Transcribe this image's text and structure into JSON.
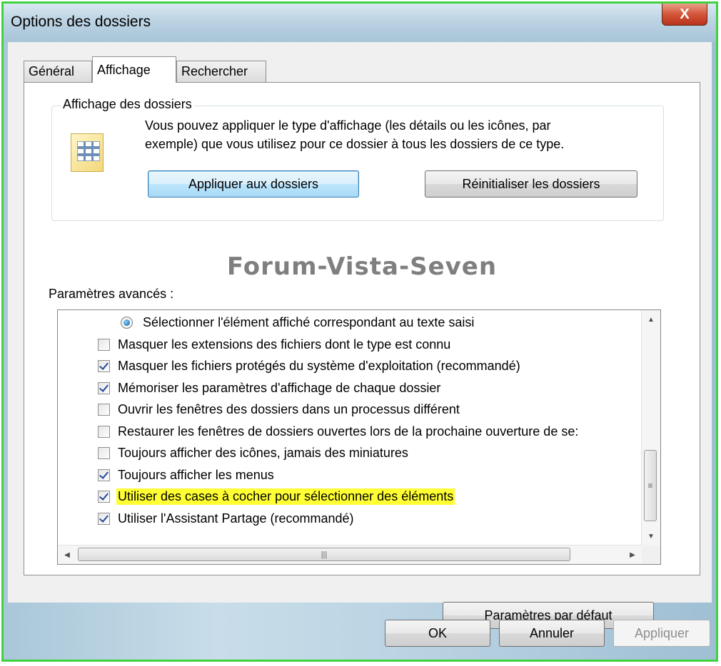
{
  "window": {
    "title": "Options des dossiers",
    "close_glyph": "X"
  },
  "tabs": [
    {
      "label": "Général",
      "active": false
    },
    {
      "label": "Affichage",
      "active": true
    },
    {
      "label": "Rechercher",
      "active": false
    }
  ],
  "folder_view": {
    "group_label": "Affichage des dossiers",
    "icon": "folder-view-icon",
    "description_line1": "Vous pouvez appliquer le type d'affichage (les détails ou les icônes, par",
    "description_line2": "exemple) que vous utilisez pour ce dossier à tous les dossiers de ce type.",
    "apply_button": "Appliquer aux dossiers",
    "reset_button": "Réinitialiser les dossiers"
  },
  "watermark": "Forum-Vista-Seven",
  "advanced": {
    "label": "Paramètres avancés :",
    "items": [
      {
        "type": "radio",
        "checked": true,
        "label": "Sélectionner l'élément affiché correspondant au texte saisi",
        "highlighted": false
      },
      {
        "type": "checkbox",
        "checked": false,
        "label": "Masquer les extensions des fichiers dont le type est connu",
        "highlighted": false
      },
      {
        "type": "checkbox",
        "checked": true,
        "label": "Masquer les fichiers protégés du système d'exploitation (recommandé)",
        "highlighted": false
      },
      {
        "type": "checkbox",
        "checked": true,
        "label": "Mémoriser les paramètres d'affichage de chaque dossier",
        "highlighted": false
      },
      {
        "type": "checkbox",
        "checked": false,
        "label": "Ouvrir les fenêtres des dossiers dans un processus différent",
        "highlighted": false
      },
      {
        "type": "checkbox",
        "checked": false,
        "label": "Restaurer les fenêtres de dossiers ouvertes lors de la prochaine ouverture de se:",
        "highlighted": false
      },
      {
        "type": "checkbox",
        "checked": false,
        "label": "Toujours afficher des icônes, jamais des miniatures",
        "highlighted": false
      },
      {
        "type": "checkbox",
        "checked": true,
        "label": "Toujours afficher les menus",
        "highlighted": false
      },
      {
        "type": "checkbox",
        "checked": true,
        "label": "Utiliser des cases à cocher pour sélectionner des éléments",
        "highlighted": true
      },
      {
        "type": "checkbox",
        "checked": true,
        "label": "Utiliser l'Assistant Partage (recommandé)",
        "highlighted": false
      }
    ],
    "defaults_button": "Paramètres par défaut"
  },
  "footer": {
    "ok": "OK",
    "cancel": "Annuler",
    "apply": "Appliquer"
  },
  "colors": {
    "highlight": "#ffff33",
    "watermark": "#7f7f7f",
    "frame_border": "#3fd33f"
  }
}
